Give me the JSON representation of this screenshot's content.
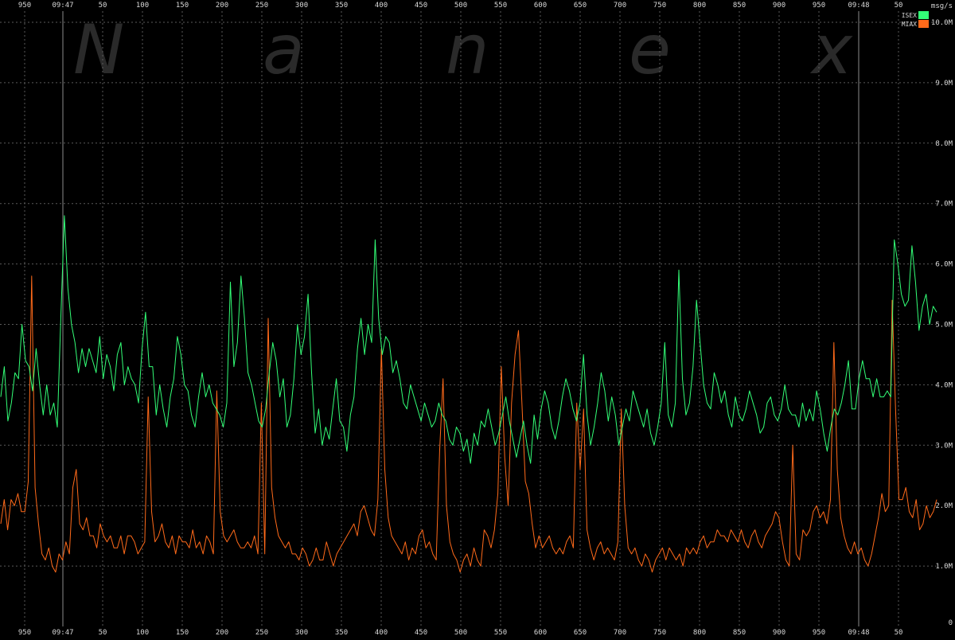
{
  "watermark": "Nanex",
  "chart_data": {
    "type": "line",
    "y_unit": "msg/s",
    "ylim": [
      0,
      10500000
    ],
    "y_ticks": [
      {
        "value": 0,
        "label": "0"
      },
      {
        "value": 1000000,
        "label": "1.0M"
      },
      {
        "value": 2000000,
        "label": "2.0M"
      },
      {
        "value": 3000000,
        "label": "3.0M"
      },
      {
        "value": 4000000,
        "label": "4.0M"
      },
      {
        "value": 5000000,
        "label": "5.0M"
      },
      {
        "value": 6000000,
        "label": "6.0M"
      },
      {
        "value": 7000000,
        "label": "7.0M"
      },
      {
        "value": 8000000,
        "label": "8.0M"
      },
      {
        "value": 9000000,
        "label": "9.0M"
      },
      {
        "value": 10000000,
        "label": "10.0M"
      }
    ],
    "x_tick_labels": [
      "950",
      "09:47",
      "50",
      "100",
      "150",
      "200",
      "250",
      "300",
      "350",
      "400",
      "450",
      "500",
      "550",
      "600",
      "650",
      "700",
      "750",
      "800",
      "850",
      "900",
      "950",
      "09:48",
      "50"
    ],
    "x_major_tick_labels": [
      "09:47",
      "09:48"
    ],
    "grid": true,
    "legend_position": "top-right",
    "series": [
      {
        "name": "ISEX",
        "color": "#33ff77",
        "values": [
          3800000,
          4300000,
          3400000,
          3700000,
          4200000,
          4100000,
          5000000,
          4400000,
          4300000,
          3900000,
          4600000,
          4000000,
          3500000,
          4000000,
          3500000,
          3700000,
          3300000,
          5100000,
          6800000,
          5600000,
          5000000,
          4700000,
          4200000,
          4600000,
          4300000,
          4600000,
          4400000,
          4200000,
          4800000,
          4100000,
          4500000,
          4300000,
          3900000,
          4500000,
          4700000,
          4000000,
          4300000,
          4100000,
          4000000,
          3700000,
          4600000,
          5200000,
          4300000,
          4300000,
          3500000,
          4000000,
          3600000,
          3300000,
          3800000,
          4100000,
          4800000,
          4500000,
          4000000,
          3900000,
          3500000,
          3300000,
          3800000,
          4200000,
          3800000,
          4000000,
          3700000,
          3600000,
          3500000,
          3300000,
          3700000,
          5700000,
          4300000,
          4700000,
          5800000,
          5100000,
          4200000,
          4000000,
          3700000,
          3400000,
          3300000,
          3600000,
          4200000,
          4700000,
          4400000,
          3800000,
          4100000,
          3300000,
          3500000,
          4100000,
          5000000,
          4500000,
          4800000,
          5500000,
          4200000,
          3200000,
          3600000,
          3000000,
          3300000,
          3100000,
          3600000,
          4100000,
          3400000,
          3300000,
          2900000,
          3500000,
          3800000,
          4600000,
          5100000,
          4500000,
          5000000,
          4700000,
          6400000,
          5100000,
          4500000,
          4800000,
          4700000,
          4200000,
          4400000,
          4100000,
          3700000,
          3600000,
          4000000,
          3800000,
          3600000,
          3400000,
          3700000,
          3500000,
          3300000,
          3400000,
          3700000,
          3500000,
          3400000,
          3100000,
          3000000,
          3300000,
          3200000,
          2900000,
          3100000,
          2700000,
          3200000,
          3000000,
          3400000,
          3300000,
          3600000,
          3300000,
          3000000,
          3200000,
          3500000,
          3800000,
          3400000,
          3100000,
          2800000,
          3100000,
          3400000,
          3000000,
          2700000,
          3500000,
          3100000,
          3600000,
          3900000,
          3700000,
          3300000,
          3100000,
          3400000,
          3800000,
          4100000,
          3900000,
          3600000,
          3400000,
          3700000,
          4500000,
          3500000,
          3000000,
          3300000,
          3700000,
          4200000,
          3900000,
          3400000,
          3800000,
          3500000,
          3000000,
          3300000,
          3600000,
          3400000,
          3900000,
          3700000,
          3500000,
          3300000,
          3600000,
          3200000,
          3000000,
          3300000,
          3700000,
          4700000,
          3500000,
          3300000,
          3700000,
          5900000,
          4100000,
          3500000,
          3700000,
          4300000,
          5400000,
          4700000,
          4000000,
          3700000,
          3600000,
          4200000,
          4000000,
          3700000,
          3900000,
          3500000,
          3300000,
          3800000,
          3500000,
          3400000,
          3600000,
          3900000,
          3700000,
          3500000,
          3200000,
          3300000,
          3700000,
          3800000,
          3500000,
          3400000,
          3600000,
          4000000,
          3600000,
          3500000,
          3500000,
          3300000,
          3700000,
          3400000,
          3600000,
          3400000,
          3900000,
          3600000,
          3200000,
          2900000,
          3300000,
          3600000,
          3500000,
          3700000,
          4000000,
          4400000,
          3600000,
          3600000,
          4100000,
          4400000,
          4100000,
          4100000,
          3800000,
          4100000,
          3800000,
          3800000,
          3900000,
          3800000,
          6400000,
          6000000,
          5500000,
          5300000,
          5400000,
          6300000,
          5700000,
          4900000,
          5300000,
          5500000,
          5000000,
          5300000,
          5200000
        ]
      },
      {
        "name": "MIAX",
        "color": "#ff6a1a",
        "values": [
          1700000,
          2100000,
          1600000,
          2100000,
          2000000,
          2200000,
          1900000,
          1900000,
          2400000,
          5800000,
          2300000,
          1700000,
          1200000,
          1100000,
          1300000,
          1000000,
          900000,
          1200000,
          1100000,
          1400000,
          1200000,
          2300000,
          2600000,
          1700000,
          1600000,
          1800000,
          1500000,
          1500000,
          1300000,
          1700000,
          1500000,
          1400000,
          1500000,
          1300000,
          1300000,
          1500000,
          1200000,
          1500000,
          1500000,
          1400000,
          1200000,
          1300000,
          1400000,
          3800000,
          1900000,
          1400000,
          1500000,
          1700000,
          1400000,
          1300000,
          1500000,
          1200000,
          1500000,
          1400000,
          1400000,
          1300000,
          1600000,
          1300000,
          1400000,
          1200000,
          1500000,
          1400000,
          1200000,
          3900000,
          1900000,
          1500000,
          1400000,
          1500000,
          1600000,
          1400000,
          1300000,
          1300000,
          1400000,
          1300000,
          1500000,
          1200000,
          3700000,
          1200000,
          5100000,
          2300000,
          1800000,
          1500000,
          1400000,
          1300000,
          1400000,
          1200000,
          1200000,
          1100000,
          1300000,
          1200000,
          1000000,
          1100000,
          1300000,
          1100000,
          1100000,
          1400000,
          1200000,
          1000000,
          1200000,
          1300000,
          1400000,
          1500000,
          1600000,
          1700000,
          1500000,
          1900000,
          2000000,
          1800000,
          1600000,
          1500000,
          2100000,
          4600000,
          2600000,
          1800000,
          1500000,
          1400000,
          1300000,
          1200000,
          1400000,
          1100000,
          1300000,
          1200000,
          1500000,
          1600000,
          1300000,
          1400000,
          1200000,
          1100000,
          2900000,
          4100000,
          2000000,
          1400000,
          1200000,
          1100000,
          900000,
          1100000,
          1200000,
          1000000,
          1300000,
          1100000,
          1000000,
          1600000,
          1500000,
          1300000,
          1600000,
          2200000,
          4300000,
          2800000,
          2000000,
          3700000,
          4500000,
          4900000,
          3700000,
          2400000,
          2200000,
          1700000,
          1300000,
          1500000,
          1300000,
          1400000,
          1500000,
          1300000,
          1200000,
          1300000,
          1200000,
          1400000,
          1500000,
          1300000,
          3700000,
          2600000,
          3600000,
          1600000,
          1300000,
          1100000,
          1300000,
          1400000,
          1200000,
          1300000,
          1200000,
          1100000,
          1400000,
          3600000,
          2000000,
          1300000,
          1200000,
          1300000,
          1100000,
          1000000,
          1200000,
          1100000,
          900000,
          1100000,
          1200000,
          1300000,
          1100000,
          1300000,
          1200000,
          1100000,
          1200000,
          1000000,
          1300000,
          1200000,
          1300000,
          1200000,
          1400000,
          1500000,
          1300000,
          1400000,
          1400000,
          1600000,
          1500000,
          1500000,
          1400000,
          1600000,
          1500000,
          1400000,
          1600000,
          1400000,
          1300000,
          1500000,
          1600000,
          1400000,
          1300000,
          1500000,
          1600000,
          1700000,
          1900000,
          1800000,
          1400000,
          1100000,
          1000000,
          3000000,
          1200000,
          1100000,
          1600000,
          1500000,
          1600000,
          1900000,
          2000000,
          1800000,
          1900000,
          1700000,
          2100000,
          4700000,
          2600000,
          1800000,
          1500000,
          1300000,
          1200000,
          1400000,
          1200000,
          1300000,
          1100000,
          1000000,
          1200000,
          1500000,
          1800000,
          2200000,
          1900000,
          2000000,
          5400000,
          3600000,
          2100000,
          2100000,
          2300000,
          1900000,
          1800000,
          2100000,
          1600000,
          1700000,
          2000000,
          1800000,
          1900000,
          2100000
        ]
      }
    ]
  }
}
